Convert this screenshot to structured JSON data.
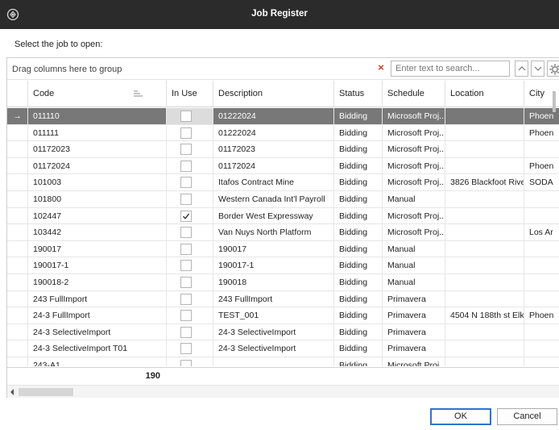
{
  "window": {
    "title": "Job Register"
  },
  "prompt": "Select the job to open:",
  "toolbar": {
    "group_hint": "Drag columns here to group",
    "search_placeholder": "Enter text to search..."
  },
  "columns": {
    "code": "Code",
    "in_use": "In Use",
    "description": "Description",
    "status": "Status",
    "schedule": "Schedule",
    "location": "Location",
    "city": "City"
  },
  "rows": [
    {
      "indicator": "→",
      "code": "011110",
      "in_use": false,
      "description": "01222024",
      "status": "Bidding",
      "schedule": "Microsoft Proj...",
      "location": "",
      "city": "Phoen",
      "selected": true
    },
    {
      "indicator": "",
      "code": "011111",
      "in_use": false,
      "description": "01222024",
      "status": "Bidding",
      "schedule": "Microsoft Proj...",
      "location": "",
      "city": "Phoen"
    },
    {
      "indicator": "",
      "code": "01172023",
      "in_use": false,
      "description": "01172023",
      "status": "Bidding",
      "schedule": "Microsoft Proj...",
      "location": "",
      "city": ""
    },
    {
      "indicator": "",
      "code": "01172024",
      "in_use": false,
      "description": "01172024",
      "status": "Bidding",
      "schedule": "Microsoft Proj...",
      "location": "",
      "city": "Phoen"
    },
    {
      "indicator": "",
      "code": "101003",
      "in_use": false,
      "description": "Itafos Contract Mine",
      "status": "Bidding",
      "schedule": "Microsoft Proj...",
      "location": "3826 Blackfoot Rive...",
      "city": "SODA"
    },
    {
      "indicator": "",
      "code": "101800",
      "in_use": false,
      "description": "Western Canada Int'l Payroll",
      "status": "Bidding",
      "schedule": "Manual",
      "location": "",
      "city": ""
    },
    {
      "indicator": "",
      "code": "102447",
      "in_use": true,
      "description": "Border West Expressway",
      "status": "Bidding",
      "schedule": "Microsoft Proj...",
      "location": "",
      "city": ""
    },
    {
      "indicator": "",
      "code": "103442",
      "in_use": false,
      "description": "Van Nuys North Platform",
      "status": "Bidding",
      "schedule": "Microsoft Proj...",
      "location": "",
      "city": "Los Ar"
    },
    {
      "indicator": "",
      "code": "190017",
      "in_use": false,
      "description": "190017",
      "status": "Bidding",
      "schedule": "Manual",
      "location": "",
      "city": ""
    },
    {
      "indicator": "",
      "code": "190017-1",
      "in_use": false,
      "description": "190017-1",
      "status": "Bidding",
      "schedule": "Manual",
      "location": "",
      "city": ""
    },
    {
      "indicator": "",
      "code": "190018-2",
      "in_use": false,
      "description": "190018",
      "status": "Bidding",
      "schedule": "Manual",
      "location": "",
      "city": ""
    },
    {
      "indicator": "",
      "code": "243 FullImport",
      "in_use": false,
      "description": "243 FullImport",
      "status": "Bidding",
      "schedule": "Primavera",
      "location": "",
      "city": ""
    },
    {
      "indicator": "",
      "code": "24-3 FullImport",
      "in_use": false,
      "description": "TEST_001",
      "status": "Bidding",
      "schedule": "Primavera",
      "location": "4504 N 188th st Elk...",
      "city": "Phoen"
    },
    {
      "indicator": "",
      "code": "24-3 SelectiveImport",
      "in_use": false,
      "description": "24-3 SelectiveImport",
      "status": "Bidding",
      "schedule": "Primavera",
      "location": "",
      "city": ""
    },
    {
      "indicator": "",
      "code": "24-3 SelectiveImport T01",
      "in_use": false,
      "description": "24-3 SelectiveImport",
      "status": "Bidding",
      "schedule": "Primavera",
      "location": "",
      "city": ""
    },
    {
      "indicator": "",
      "code": "243-A1",
      "in_use": false,
      "description": "",
      "status": "Bidding",
      "schedule": "Microsoft Proj...",
      "location": "",
      "city": ""
    }
  ],
  "footer": {
    "count": "190"
  },
  "buttons": {
    "ok": "OK",
    "cancel": "Cancel"
  },
  "colors": {
    "titlebar": "#2b2b2b",
    "selected_row": "#787878",
    "focus_cell": "#dcdcdc",
    "clear_icon": "#d23a1e",
    "ok_border": "#2a75d2"
  },
  "icons": {
    "app": "app-logo-icon",
    "clear": "clear-filter-icon",
    "nav_up": "chevron-up-icon",
    "nav_down": "chevron-down-icon",
    "settings": "gear-icon",
    "sort": "sort-icon",
    "row_indicator": "current-row-arrow-icon",
    "check": "check-icon"
  }
}
